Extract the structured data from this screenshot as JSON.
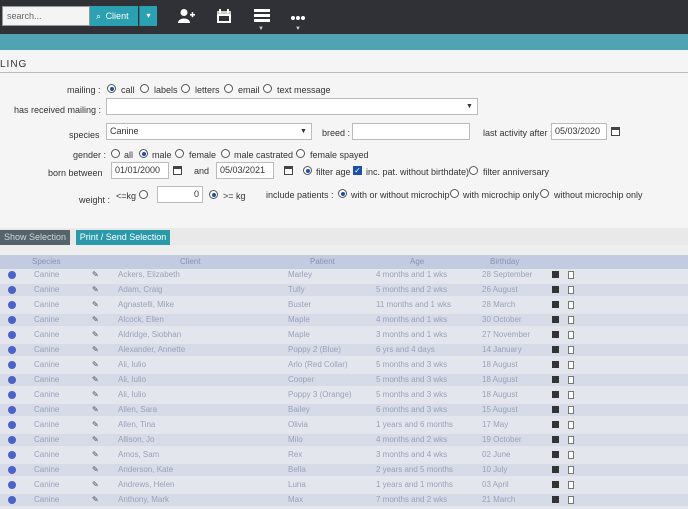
{
  "toolbar": {
    "search_placeholder": "search...",
    "client_label": "Client",
    "icons": [
      "add-user-icon",
      "calendar-icon",
      "list-icon",
      "more-icon"
    ]
  },
  "section": {
    "title": "LING"
  },
  "form": {
    "mailing_label": "mailing :",
    "mailing_options": [
      "call",
      "labels",
      "letters",
      "email",
      "text message"
    ],
    "mailing_selected": "call",
    "received_label": "has received mailing :",
    "received_value": "",
    "species_label": "species",
    "species_value": "Canine",
    "breed_label": "breed :",
    "breed_value": "",
    "last_activity_label": "last activity after :",
    "last_activity_value": "05/03/2020",
    "gender_label": "gender :",
    "gender_options": [
      "all",
      "male",
      "female",
      "male castrated",
      "female spayed"
    ],
    "gender_selected": "male",
    "born_label": "born between",
    "born_from": "01/01/2000",
    "born_and": "and",
    "born_to": "05/03/2021",
    "filter_age_label": "filter age",
    "inc_pat_label": "inc. pat. without birthdate)",
    "filter_anniv_label": "filter anniversary",
    "weight_label": "weight :",
    "weight_lt": "<=kg",
    "weight_value": "0",
    "weight_gt": ">= kg",
    "include_label": "include patients :",
    "microchip_options": [
      "with or without microchip",
      "with microchip only",
      "without microchip only"
    ],
    "microchip_selected": "with or without microchip"
  },
  "buttons": {
    "show_selection": "Show Selection",
    "print_send": "Print / Send Selection"
  },
  "table": {
    "headers": [
      "Species",
      "Client",
      "Patient",
      "Age",
      "Birthday"
    ],
    "rows": [
      [
        "Canine",
        "Ackers, Elizabeth",
        "Marley",
        "4 months and 1 wks",
        "28 September"
      ],
      [
        "Canine",
        "Adam, Craig",
        "Tully",
        "5 months and 2 wks",
        "26 August"
      ],
      [
        "Canine",
        "Agnastelli, Mike",
        "Buster",
        "11 months and 1 wks",
        "28 March"
      ],
      [
        "Canine",
        "Alcock, Ellen",
        "Maple",
        "4 months and 1 wks",
        "30 October"
      ],
      [
        "Canine",
        "Aldridge, Siobhan",
        "Maple",
        "3 months and 1 wks",
        "27 November"
      ],
      [
        "Canine",
        "Alexander, Annette",
        "Poppy 2 (Blue)",
        "6 yrs and 4 days",
        "14 January"
      ],
      [
        "Canine",
        "Ali, Iulio",
        "Arlo (Red Collar)",
        "5 months and 3 wks",
        "18 August"
      ],
      [
        "Canine",
        "Ali, Iulio",
        "Cooper",
        "5 months and 3 wks",
        "18 August"
      ],
      [
        "Canine",
        "Ali, Iulio",
        "Poppy 3 (Orange)",
        "5 months and 3 wks",
        "18 August"
      ],
      [
        "Canine",
        "Allen, Sara",
        "Bailey",
        "6 months and 3 wks",
        "15 August"
      ],
      [
        "Canine",
        "Allen, Tina",
        "Olivia",
        "1 years and 6 months",
        "17 May"
      ],
      [
        "Canine",
        "Allison, Jo",
        "Milo",
        "4 months and 2 wks",
        "19 October"
      ],
      [
        "Canine",
        "Amos, Sam",
        "Rex",
        "3 months and 4 wks",
        "02 June"
      ],
      [
        "Canine",
        "Anderson, Kate",
        "Bella",
        "2 years and 5 months",
        "10 July"
      ],
      [
        "Canine",
        "Andrews, Helen",
        "Luna",
        "1 years and 1 months",
        "03 April"
      ],
      [
        "Canine",
        "Anthony, Mark",
        "Max",
        "7 months and 2 wks",
        "21 March"
      ]
    ]
  },
  "colors": {
    "accent": "#2aa0b0",
    "topbar": "#2f3136",
    "radio": "#1e4fa8"
  }
}
